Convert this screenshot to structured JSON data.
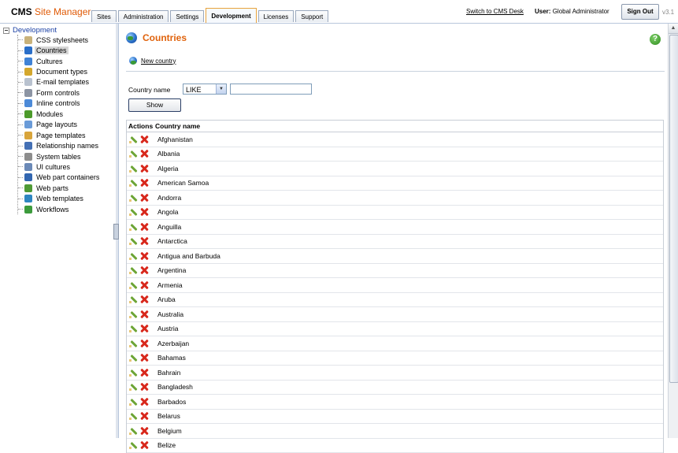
{
  "header": {
    "logo_cms": "CMS",
    "logo_site_manager": "Site Manager",
    "tabs": [
      "Sites",
      "Administration",
      "Settings",
      "Development",
      "Licenses",
      "Support"
    ],
    "active_tab": "Development",
    "switch_link": "Switch to CMS Desk",
    "user_label": "User:",
    "user_name": "Global Administrator",
    "sign_out": "Sign Out",
    "version": "v3.1"
  },
  "sidebar": {
    "root": "Development",
    "items": [
      {
        "label": "CSS stylesheets",
        "icon": "css-stylesheets-icon",
        "color": "#c9b27a"
      },
      {
        "label": "Countries",
        "icon": "globe-icon",
        "color": "#2a6fc9"
      },
      {
        "label": "Cultures",
        "icon": "globe-icon",
        "color": "#3f82d6"
      },
      {
        "label": "Document types",
        "icon": "document-types-icon",
        "color": "#d4a72c"
      },
      {
        "label": "E-mail templates",
        "icon": "email-icon",
        "color": "#b9c2cf"
      },
      {
        "label": "Form controls",
        "icon": "form-controls-icon",
        "color": "#8c94a3"
      },
      {
        "label": "Inline controls",
        "icon": "inline-controls-icon",
        "color": "#4c8ad8"
      },
      {
        "label": "Modules",
        "icon": "modules-icon",
        "color": "#4c9a2a"
      },
      {
        "label": "Page layouts",
        "icon": "page-layouts-icon",
        "color": "#6a9bd8"
      },
      {
        "label": "Page templates",
        "icon": "page-templates-icon",
        "color": "#d9a53b"
      },
      {
        "label": "Relationship names",
        "icon": "relationship-icon",
        "color": "#4470b5"
      },
      {
        "label": "System tables",
        "icon": "system-tables-icon",
        "color": "#8d8d8d"
      },
      {
        "label": "UI cultures",
        "icon": "ui-cultures-icon",
        "color": "#6b89b7"
      },
      {
        "label": "Web part containers",
        "icon": "web-part-containers-icon",
        "color": "#3266b0"
      },
      {
        "label": "Web parts",
        "icon": "web-parts-icon",
        "color": "#4f9a35"
      },
      {
        "label": "Web templates",
        "icon": "web-templates-icon",
        "color": "#2e86c1"
      },
      {
        "label": "Workflows",
        "icon": "workflows-icon",
        "color": "#3c9b3c"
      }
    ],
    "selected": "Countries"
  },
  "main": {
    "title": "Countries",
    "new_country": "New country",
    "filter": {
      "label": "Country name",
      "operator": "LIKE",
      "value": "",
      "show_button": "Show"
    },
    "grid": {
      "columns": [
        "Actions",
        "Country name"
      ],
      "rows": [
        "Afghanistan",
        "Albania",
        "Algeria",
        "American Samoa",
        "Andorra",
        "Angola",
        "Anguilla",
        "Antarctica",
        "Antigua and Barbuda",
        "Argentina",
        "Armenia",
        "Aruba",
        "Australia",
        "Austria",
        "Azerbaijan",
        "Bahamas",
        "Bahrain",
        "Bangladesh",
        "Barbados",
        "Belarus",
        "Belgium",
        "Belize"
      ]
    }
  }
}
